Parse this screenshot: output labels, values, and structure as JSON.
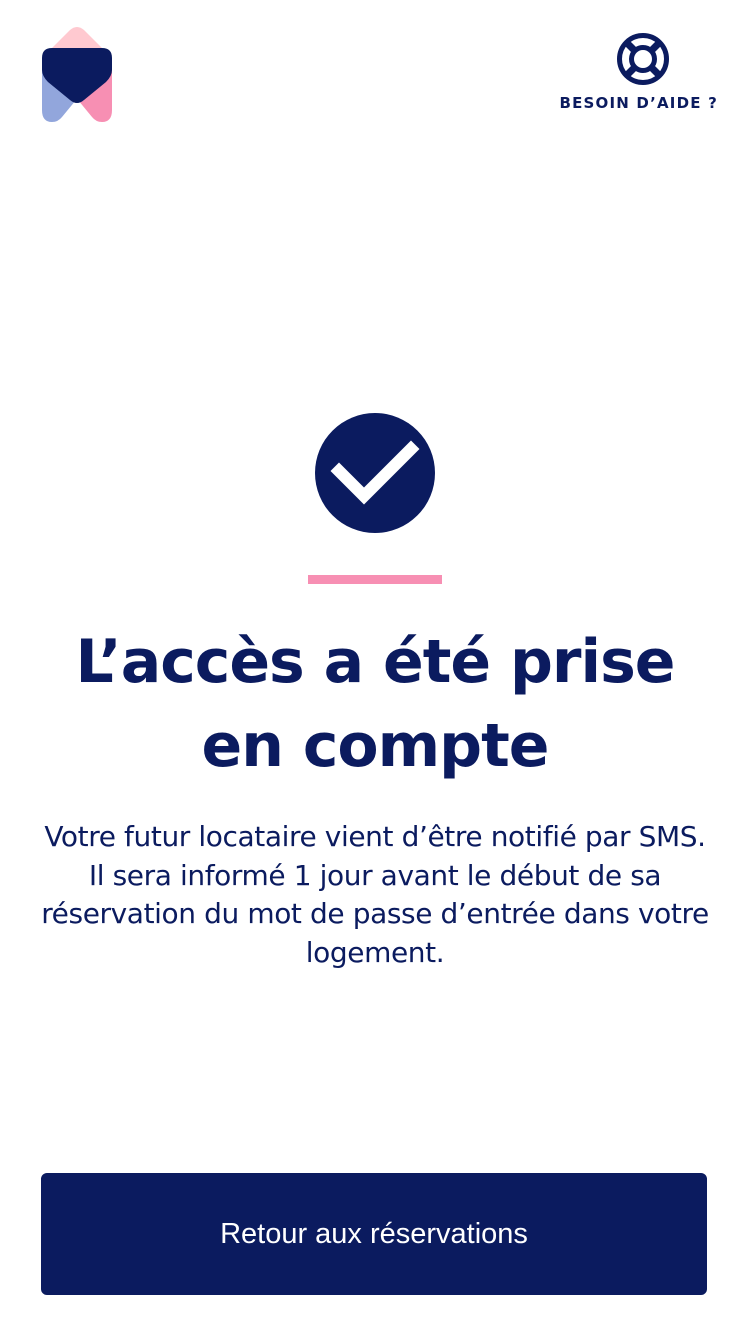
{
  "header": {
    "logo_icon": "brand-house-logo-icon",
    "help": {
      "icon": "lifebuoy-icon",
      "label": "BESOIN D’AIDE ?"
    }
  },
  "confirmation": {
    "status_icon": "check-circle-icon",
    "title": "L’accès a été prise\nen compte",
    "message": "Votre futur locataire vient d’être notifié par SMS. Il sera informé 1 jour avant le début de sa réservation du mot de passe d’entrée dans votre logement."
  },
  "footer": {
    "button_label": "Retour aux réservations"
  },
  "colors": {
    "primary": "#0b1b5f",
    "accent_pink": "#f78fb3",
    "light_pink": "#ffc9d0",
    "light_blue": "#92a6dc",
    "background": "#ffffff"
  }
}
